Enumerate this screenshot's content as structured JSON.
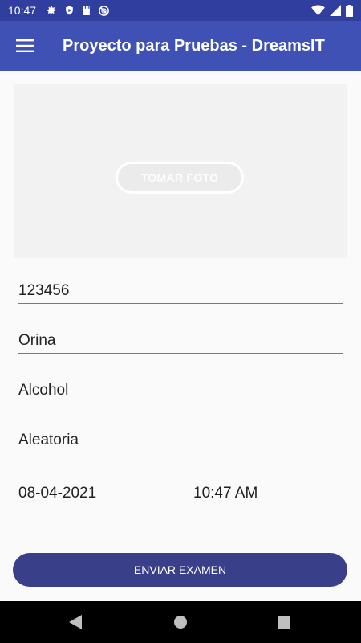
{
  "status_bar": {
    "time": "10:47",
    "left_icons": [
      "gear-icon",
      "shield-icon",
      "sd-card-icon",
      "no-disturb-icon"
    ],
    "right_icons": [
      "wifi-icon",
      "cell-signal-icon",
      "battery-icon"
    ]
  },
  "app_bar": {
    "title": "Proyecto para Pruebas - DreamsIT",
    "menu_icon": "hamburger-menu-icon"
  },
  "photo": {
    "button_label": "TOMAR FOTO"
  },
  "form": {
    "field_1": "123456",
    "field_2": "Orina",
    "field_3": "Alcohol",
    "field_4": "Aleatoria",
    "date": "08-04-2021",
    "time": "10:47 AM"
  },
  "submit": {
    "label": "ENVIAR EXAMEN"
  },
  "nav_bar": {
    "items": [
      "back-icon",
      "home-icon",
      "recents-icon"
    ]
  },
  "colors": {
    "status_bar": "#303f9f",
    "app_bar": "#3f51b5",
    "submit_button": "#3a3f8a"
  }
}
